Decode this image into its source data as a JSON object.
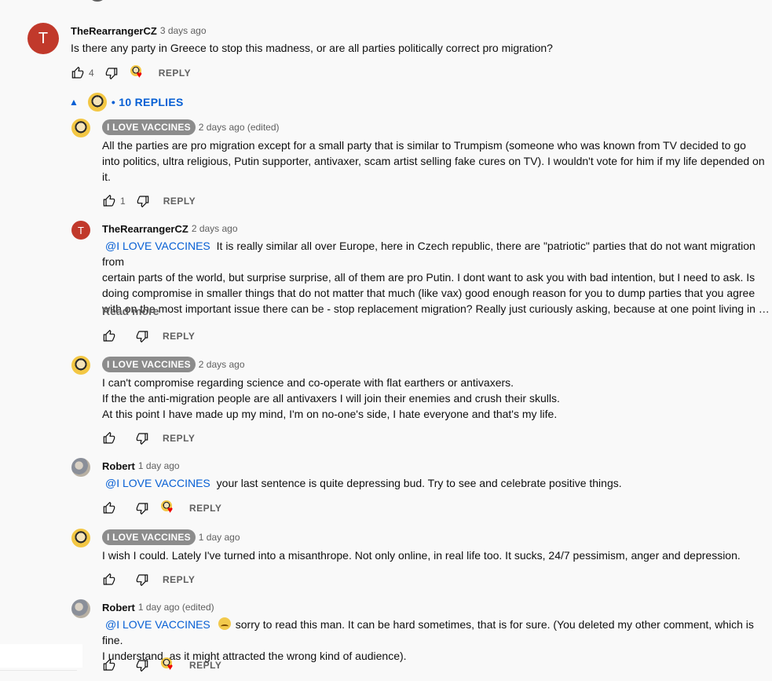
{
  "top_comment": {
    "avatar_letter": "T",
    "author": "TheRearrangerCZ",
    "time": "3 days ago",
    "text": "Is there any party in Greece to stop this madness, or are all parties politically correct pro migration?",
    "likes": "4",
    "reply_label": "REPLY"
  },
  "replies_toggle": {
    "caret": "▲",
    "label": "• 10 REPLIES"
  },
  "replies": [
    {
      "author": "I LOVE VACCINES",
      "time": "2 days ago (edited)",
      "lines": [
        "All the parties are pro migration except for a small party that is similar to Trumpism (someone who was known from TV decided to go",
        "into politics, ultra religious, Putin supporter, antivaxer, scam artist selling fake cures on TV). I wouldn't vote for him if my life depended on",
        "it."
      ],
      "likes": "1",
      "reply_label": "REPLY"
    },
    {
      "avatar_letter": "T",
      "author": "TheRearrangerCZ",
      "time": "2 days ago",
      "mention": "@I LOVE VACCINES",
      "lines": [
        "It is really similar all over Europe, here in Czech republic, there are \"patriotic\" parties that do not want migration from",
        "certain parts of the world, but surprise surprise, all of them are pro Putin. I dont want to ask you with bad intention, but I need to ask. Is",
        "doing compromise in smaller things that do not matter that much (like vax) good enough reason for you to dump parties that you agree",
        "with on the most important issue there can be - stop replacement migration? Really just curiously asking, because at one point living in …"
      ],
      "read_more": "Read more",
      "likes": "",
      "reply_label": "REPLY"
    },
    {
      "author": "I LOVE VACCINES",
      "time": "2 days ago",
      "lines": [
        "I can't compromise regarding science and co-operate with flat earthers or antivaxers.",
        "If the the anti-migration people are all antivaxers I will join their enemies and crush their skulls.",
        "At this point I have made up my mind, I'm on no-one's side, I hate everyone and that's my life."
      ],
      "likes": "",
      "reply_label": "REPLY"
    },
    {
      "author": "Robert",
      "time": "1 day ago",
      "mention": "@I LOVE VACCINES",
      "lines": [
        "your last sentence is quite depressing bud. Try to see and celebrate positive things."
      ],
      "likes": "",
      "reply_label": "REPLY"
    },
    {
      "author": "I LOVE VACCINES",
      "time": "1 day ago",
      "lines": [
        "I wish I could. Lately I've turned into a misanthrope. Not only online, in real life too. It sucks, 24/7 pessimism, anger and depression."
      ],
      "likes": "",
      "reply_label": "REPLY"
    },
    {
      "author": "Robert",
      "time": "1 day ago (edited)",
      "mention": "@I LOVE VACCINES",
      "lines": [
        "sorry to read this man. It can be hard sometimes, that is for sure. (You deleted my other comment, which is fine.",
        "I understand, as it might attracted the wrong kind of audience)."
      ],
      "likes": "",
      "reply_label": "REPLY"
    }
  ],
  "icons": {
    "like": "thumbs-up-icon",
    "dislike": "thumbs-down-icon",
    "creator_heart": "creator-heart-icon",
    "sad_emoji": "sad-face-emoji"
  },
  "colors": {
    "link": "#065fd4",
    "badge": "#8c8c8c",
    "avatar_red": "#c1392b",
    "heart": "#e00000"
  }
}
